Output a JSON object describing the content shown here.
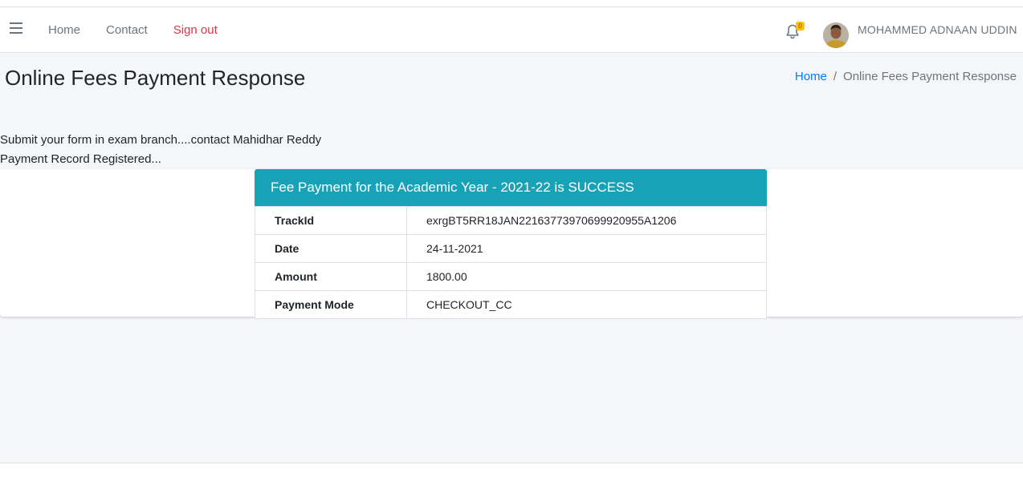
{
  "nav": {
    "links": [
      "Home",
      "Contact",
      "Sign out"
    ],
    "notification_count": "0",
    "user_name": "MOHAMMED ADNAAN UDDIN"
  },
  "page": {
    "title": "Online Fees Payment Response",
    "breadcrumb": [
      "Home",
      "/",
      "Online Fees Payment Response"
    ]
  },
  "messages": [
    "Submit your form in exam branch....contact Mahidhar Reddy",
    "Payment Record Registered..."
  ],
  "payment": {
    "header": "Fee Payment for the Academic Year - 2021-22 is SUCCESS",
    "rows": [
      {
        "label": "TrackId",
        "value": "exrgBT5RR18JAN22163773970699920955A1206"
      },
      {
        "label": "Date",
        "value": "24-11-2021"
      },
      {
        "label": "Amount",
        "value": "1800.00"
      },
      {
        "label": "Payment Mode",
        "value": "CHECKOUT_CC"
      }
    ]
  },
  "colors": {
    "accent_header": "#17a2b8",
    "link": "#007bff",
    "signout": "#dc3545",
    "badge": "#ffc107",
    "background": "#f4f6f9"
  },
  "icons": [
    "menu-icon",
    "bell-icon",
    "user-avatar"
  ]
}
